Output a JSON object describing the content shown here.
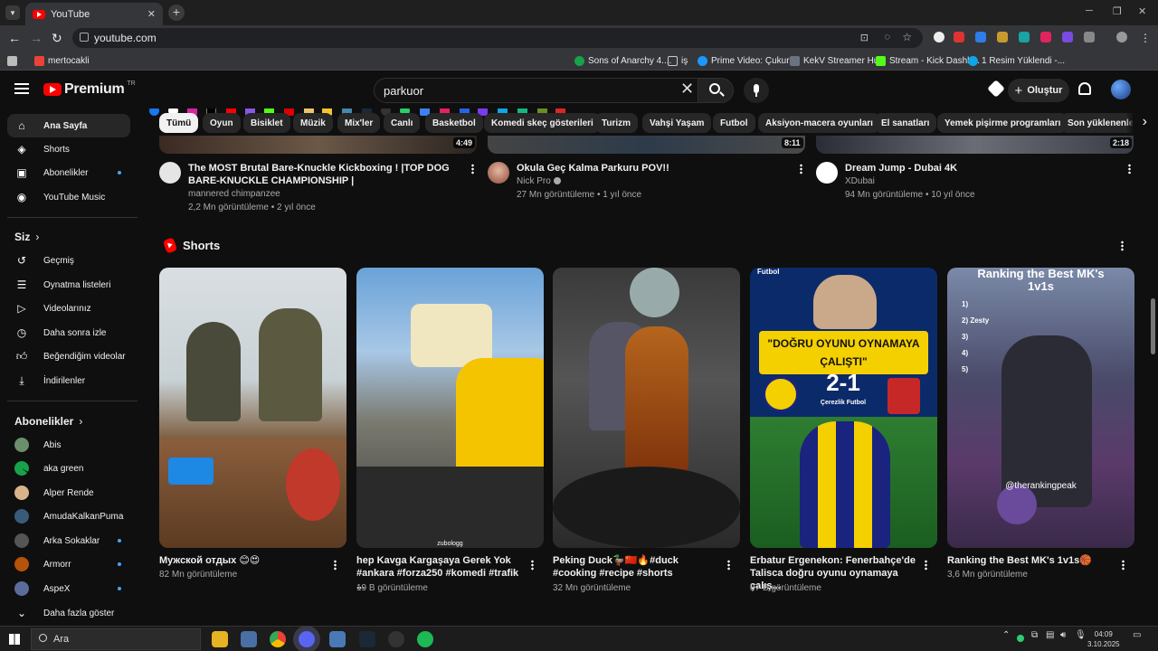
{
  "browser": {
    "tab_title": "YouTube",
    "url": "youtube.com",
    "bookmarks": [
      "mertocakli",
      "Sons of Anarchy 4....",
      "iş",
      "Prime Video: Çukur...",
      "KekV Streamer Hub",
      "Stream - Kick Dashb...",
      "1 Resim Yüklendi -..."
    ]
  },
  "header": {
    "logo_text": "Premium",
    "logo_sup": "TR",
    "search_value": "parkuor",
    "create_label": "Oluştur"
  },
  "sidebar": {
    "main": [
      "Ana Sayfa",
      "Shorts",
      "Abonelikler",
      "YouTube Music"
    ],
    "you_heading": "Siz",
    "you_items": [
      "Geçmiş",
      "Oynatma listeleri",
      "Videolarınız",
      "Daha sonra izle",
      "Beğendiğim videolar",
      "İndirilenler"
    ],
    "subs_heading": "Abonelikler",
    "subs": [
      "Abis",
      "aka green",
      "Alper Rende",
      "AmudaKalkanPuma",
      "Arka Sokaklar",
      "Armorr",
      "AspeX"
    ],
    "show_more": "Daha fazla göster"
  },
  "chips": [
    "Tümü",
    "Oyun",
    "Bisiklet",
    "Müzik",
    "Mix'ler",
    "Canlı",
    "Basketbol",
    "Komedi skeç gösterileri",
    "Turizm",
    "Vahşi Yaşam",
    "Futbol",
    "Aksiyon-macera oyunları",
    "El sanatları",
    "Yemek pişirme programları",
    "Son yüklenenler"
  ],
  "videos": [
    {
      "duration": "4:49",
      "title": "The MOST Brutal Bare-Knuckle Kickboxing ! |TOP DOG BARE-KNUCKLE CHAMPIONSHIP |",
      "channel": "mannered chimpanzee",
      "meta": "2,2 Mn görüntüleme • 2 yıl önce"
    },
    {
      "duration": "8:11",
      "title": "Okula Geç Kalma Parkuru POV!!",
      "channel": "Nick Pro",
      "meta": "27 Mn görüntüleme • 1 yıl önce"
    },
    {
      "duration": "2:18",
      "title": "Dream Jump - Dubai 4K",
      "channel": "XDubai",
      "meta": "94 Mn görüntüleme • 10 yıl önce"
    }
  ],
  "shorts_heading": "Shorts",
  "shorts": [
    {
      "title": "Мужской отдых 😊😍",
      "views": "82 Mn görüntüleme"
    },
    {
      "title": "hep Kavga Kargaşaya Gerek Yok #ankara #forza250 #komedi #trafik ...",
      "views": "19 B görüntüleme",
      "overlay": "zubologg"
    },
    {
      "title": "Peking Duck🦆🇨🇳🔥#duck #cooking #recipe #shorts",
      "views": "32 Mn görüntüleme"
    },
    {
      "title": "Erbatur Ergenekon: Fenerbahçe'de Talisca doğru oyunu oynamaya çalış...",
      "views": "87 B görüntüleme",
      "overlay_tag": "Futbol",
      "overlay_quote": "\"DOĞRU OYUNU OYNAMAYA ÇALIŞTI\"",
      "overlay_score": "2-1",
      "overlay_sub": "Çerezlik Futbol"
    },
    {
      "title": "Ranking the Best MK's 1v1s🏀",
      "views": "3,6 Mn görüntüleme",
      "overlay_head": "Ranking the Best MK's 1v1s",
      "overlay_handle": "@therankingpeak",
      "overlay_rank": [
        "1)",
        "2) Zesty",
        "3)",
        "4)",
        "5)"
      ]
    }
  ],
  "taskbar": {
    "search_label": "Ara",
    "time": "04:09",
    "date": "3.10.2025"
  }
}
